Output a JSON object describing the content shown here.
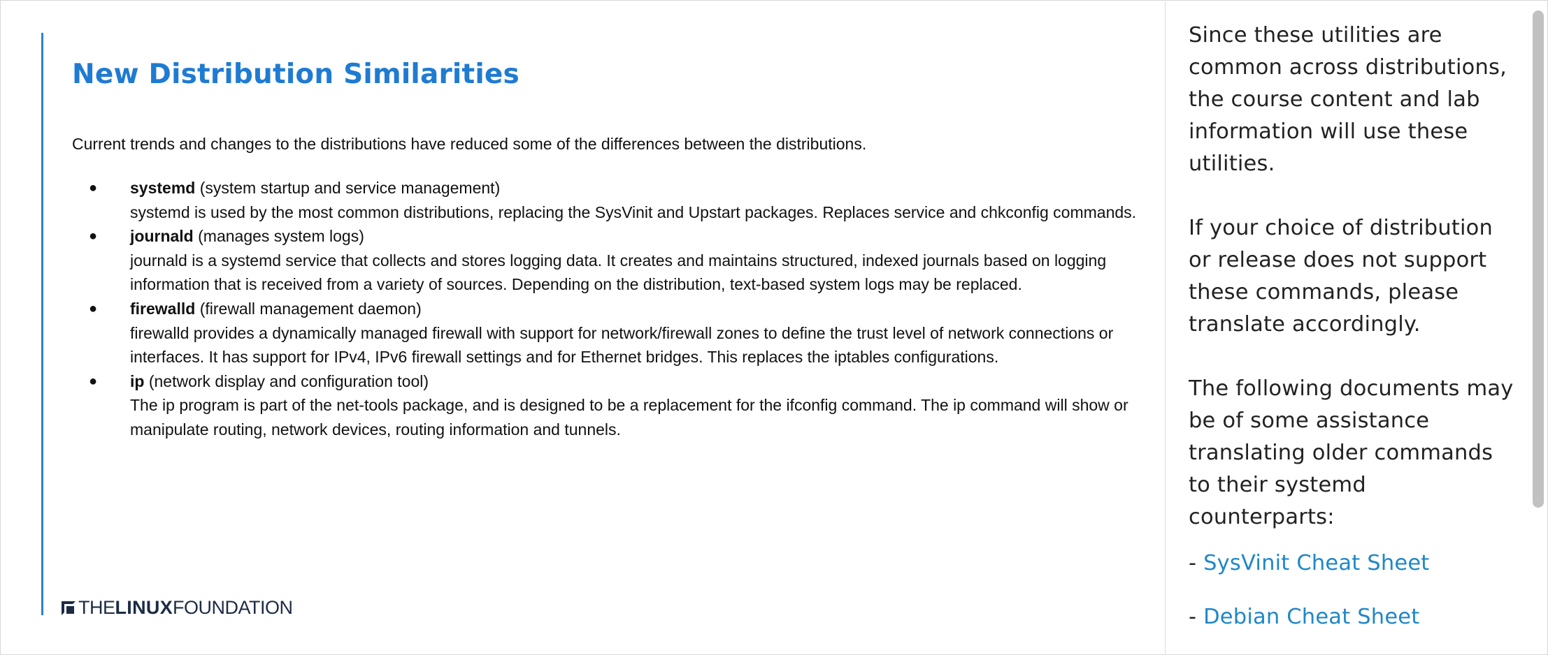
{
  "slide": {
    "title": "New Distribution Similarities",
    "intro": "Current trends and changes to the distributions have reduced some of the differences between the distributions.",
    "bullet_symbol": "●",
    "items": [
      {
        "term": "systemd",
        "qualifier": " (system startup and service management)",
        "description": "systemd is used by the most common distributions, replacing the SysVinit and Upstart packages. Replaces service and chkconfig commands."
      },
      {
        "term": "journald",
        "qualifier": " (manages system logs)",
        "description": "journald is a systemd service that collects and stores logging data. It creates and maintains structured, indexed journals based on logging information that is received from a variety of sources. Depending on the distribution, text-based system logs may be replaced."
      },
      {
        "term": "firewalld",
        "qualifier": " (firewall management daemon)",
        "description": "firewalld provides a dynamically managed firewall with support for network/firewall zones to define the trust level of network connections or interfaces. It has support for IPv4, IPv6 firewall settings and for Ethernet bridges. This replaces the iptables configurations."
      },
      {
        "term": "ip",
        "qualifier": " (network display and configuration tool)",
        "description": "The ip program is part of the net-tools package, and is designed to be a replacement for the ifconfig command. The ip command will show or manipulate routing, network devices, routing information and tunnels."
      }
    ],
    "logo": {
      "the": "THE",
      "linux": "LINUX",
      "foundation": "FOUNDATION"
    }
  },
  "notes": {
    "paragraphs": [
      "Since these utilities are common across distributions, the course content and lab information will use these utilities.",
      "If your choice of distribution or release does not support these commands, please translate accordingly.",
      "The following documents may be of some assistance translating older commands to their systemd counterparts:"
    ],
    "link_prefix": "- ",
    "links": [
      {
        "label": "SysVinit Cheat Sheet"
      },
      {
        "label": "Debian Cheat Sheet"
      }
    ]
  },
  "colors": {
    "title_blue": "#1f7bd2",
    "accent_rule": "#2f7fd0",
    "link_blue": "#1f87c8",
    "logo_navy": "#1d2b44"
  }
}
